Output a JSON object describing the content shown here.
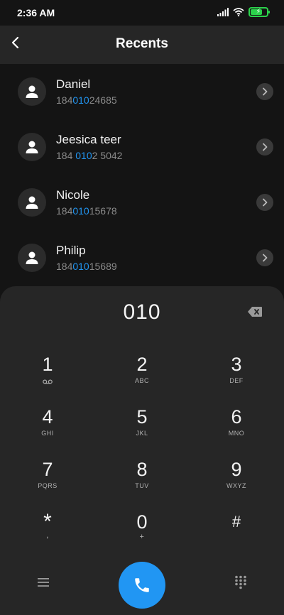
{
  "status_bar": {
    "time": "2:36 AM"
  },
  "header": {
    "title": "Recents"
  },
  "contacts": [
    {
      "name": "Daniel",
      "number_pre": "184",
      "number_match": "010",
      "number_post": "24685"
    },
    {
      "name": "Jeesica teer",
      "number_pre": "184 ",
      "number_match": "010",
      "number_post": "2 5042"
    },
    {
      "name": "Nicole",
      "number_pre": "184",
      "number_match": "010",
      "number_post": "15678"
    },
    {
      "name": "Philip",
      "number_pre": "184",
      "number_match": "010",
      "number_post": "15689"
    }
  ],
  "dialpad": {
    "display": "010",
    "keys": [
      {
        "digit": "1",
        "sub": ""
      },
      {
        "digit": "2",
        "sub": "ABC"
      },
      {
        "digit": "3",
        "sub": "DEF"
      },
      {
        "digit": "4",
        "sub": "GHI"
      },
      {
        "digit": "5",
        "sub": "JKL"
      },
      {
        "digit": "6",
        "sub": "MNO"
      },
      {
        "digit": "7",
        "sub": "PQRS"
      },
      {
        "digit": "8",
        "sub": "TUV"
      },
      {
        "digit": "9",
        "sub": "WXYZ"
      },
      {
        "digit": "*",
        "sub": ","
      },
      {
        "digit": "0",
        "sub": "+"
      },
      {
        "digit": "#",
        "sub": ""
      }
    ]
  },
  "colors": {
    "accent": "#2196f3",
    "battery": "#2bd24b",
    "background": "#141414",
    "panel": "#262626"
  },
  "icons": {
    "voicemail": "voicemail-icon",
    "back": "back-arrow-icon",
    "backspace": "backspace-icon",
    "call": "phone-icon",
    "menu": "menu-icon",
    "keypad": "keypad-icon"
  }
}
